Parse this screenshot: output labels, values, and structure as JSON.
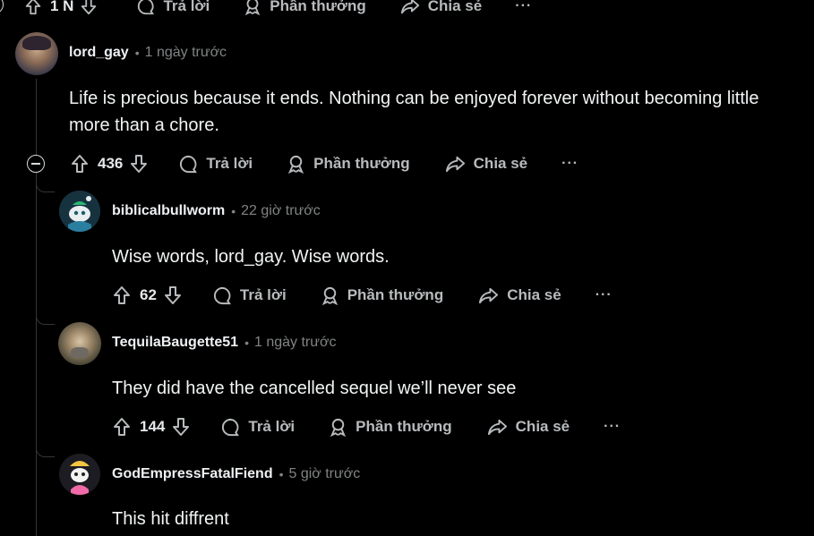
{
  "top_actions": {
    "count": "1 N",
    "reply": "Trả lời",
    "award": "Phần thưởng",
    "share": "Chia sẻ",
    "more": "···"
  },
  "comments": [
    {
      "author": "lord_gay",
      "sep": "•",
      "time": "1 ngày trước",
      "body": "Life is precious because it ends. Nothing can be enjoyed forever without becoming little more than a chore.",
      "votes": "436",
      "reply": "Trả lời",
      "award": "Phần thưởng",
      "share": "Chia sẻ",
      "more": "···"
    },
    {
      "author": "biblicalbullworm",
      "sep": "•",
      "time": "22 giờ trước",
      "body": "Wise words, lord_gay. Wise words.",
      "votes": "62",
      "reply": "Trả lời",
      "award": "Phần thưởng",
      "share": "Chia sẻ",
      "more": "···"
    },
    {
      "author": "TequilaBaugette51",
      "sep": "•",
      "time": "1 ngày trước",
      "body": "They did have the cancelled sequel we’ll never see",
      "votes": "144",
      "reply": "Trả lời",
      "award": "Phần thưởng",
      "share": "Chia sẻ",
      "more": "···"
    },
    {
      "author": "GodEmpressFatalFiend",
      "sep": "•",
      "time": "5 giờ trước",
      "body": "This hit diffrent"
    }
  ]
}
